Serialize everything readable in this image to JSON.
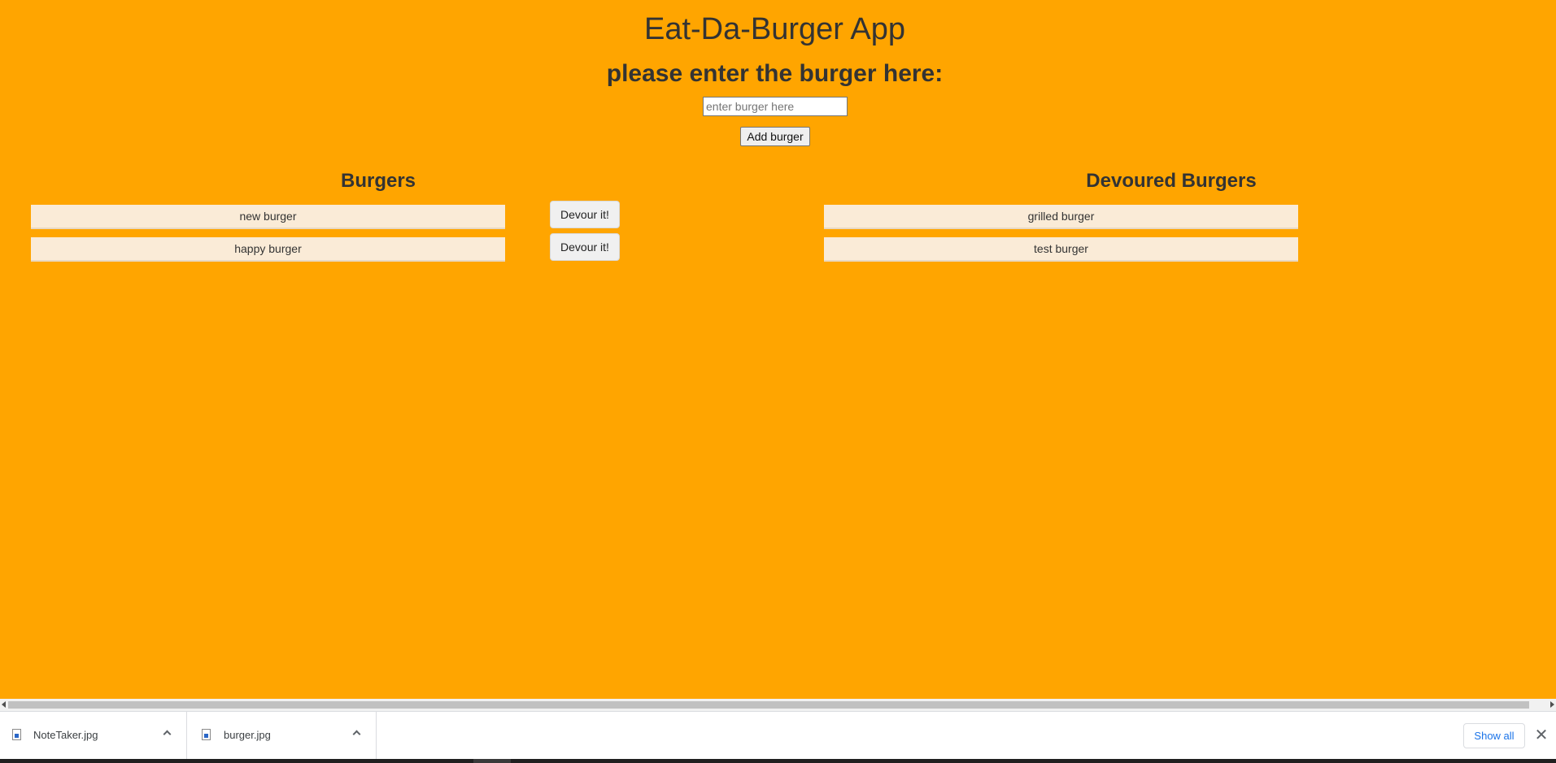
{
  "header": {
    "title": "Eat-Da-Burger App",
    "prompt": "please enter the burger here:"
  },
  "form": {
    "input_placeholder": "enter burger here",
    "input_value": "",
    "add_button_label": "Add burger"
  },
  "burgers": {
    "heading": "Burgers",
    "items": [
      {
        "name": "new burger",
        "button_label": "Devour it!"
      },
      {
        "name": "happy burger",
        "button_label": "Devour it!"
      }
    ]
  },
  "devoured": {
    "heading": "Devoured Burgers",
    "items": [
      {
        "name": "grilled burger"
      },
      {
        "name": "test burger"
      }
    ]
  },
  "download_shelf": {
    "items": [
      {
        "filename": "NoteTaker.jpg",
        "icon": "image-file-icon"
      },
      {
        "filename": "burger.jpg",
        "icon": "image-file-icon"
      }
    ],
    "show_all_label": "Show all",
    "close_glyph": "✕"
  },
  "colors": {
    "page_background": "#ffa500",
    "burger_item_background": "#faebd7",
    "text": "#333333",
    "link_blue": "#1a73e8"
  }
}
